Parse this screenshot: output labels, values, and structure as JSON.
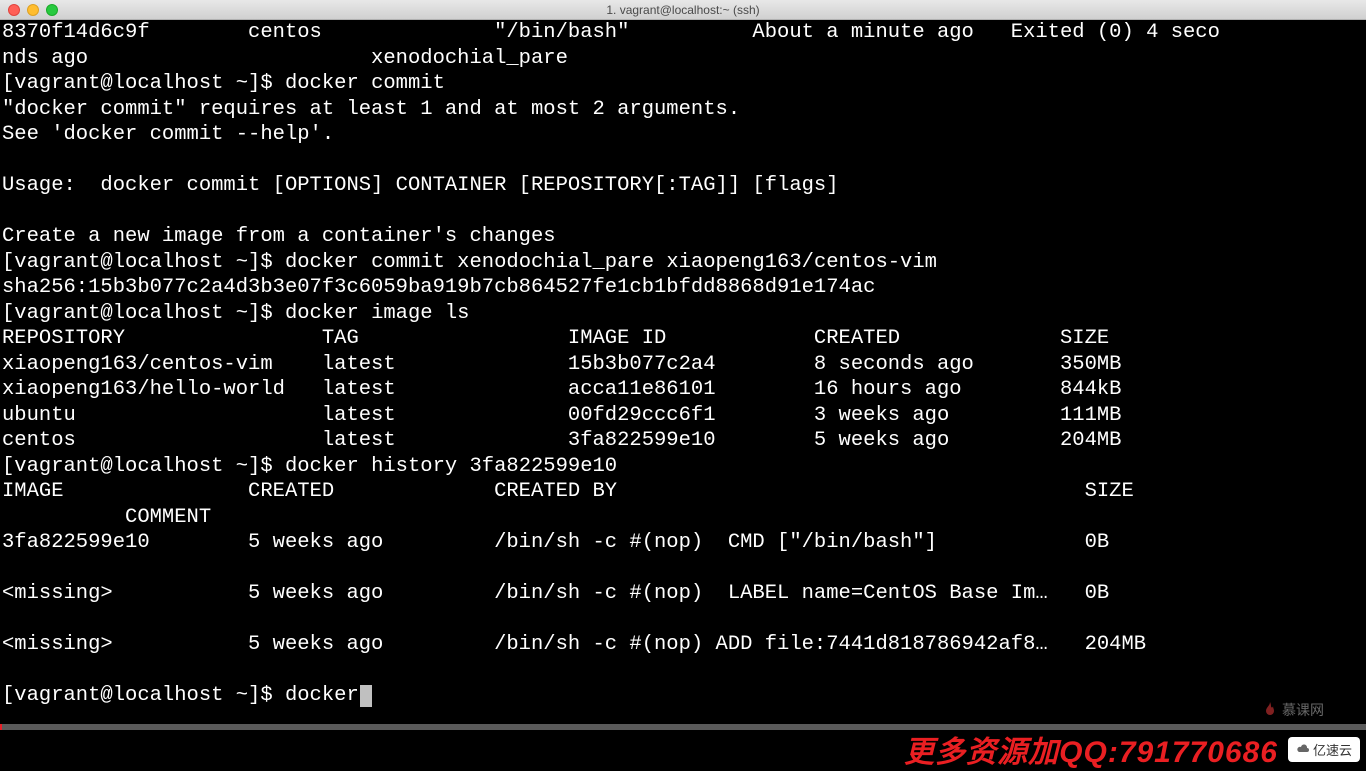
{
  "window": {
    "title": "1. vagrant@localhost:~ (ssh)"
  },
  "terminal": {
    "prompt": "[vagrant@localhost ~]$ ",
    "lines": {
      "l1": "8370f14d6c9f        centos              \"/bin/bash\"          About a minute ago   Exited (0) 4 seco",
      "l2": "nds ago                       xenodochial_pare",
      "l3_cmd": "docker commit",
      "l4": "\"docker commit\" requires at least 1 and at most 2 arguments.",
      "l5": "See 'docker commit --help'.",
      "l6": "",
      "l7": "Usage:  docker commit [OPTIONS] CONTAINER [REPOSITORY[:TAG]] [flags]",
      "l8": "",
      "l9": "Create a new image from a container's changes",
      "l10_cmd": "docker commit xenodochial_pare xiaopeng163/centos-vim",
      "l11": "sha256:15b3b077c2a4d3b3e07f3c6059ba919b7cb864527fe1cb1bfdd8868d91e174ac",
      "l12_cmd": "docker image ls",
      "image_table": {
        "header": "REPOSITORY                TAG                 IMAGE ID            CREATED             SIZE",
        "rows": [
          "xiaopeng163/centos-vim    latest              15b3b077c2a4        8 seconds ago       350MB",
          "xiaopeng163/hello-world   latest              acca11e86101        16 hours ago        844kB",
          "ubuntu                    latest              00fd29ccc6f1        3 weeks ago         111MB",
          "centos                    latest              3fa822599e10        5 weeks ago         204MB"
        ]
      },
      "l18_cmd": "docker history 3fa822599e10",
      "history_table": {
        "header1": "IMAGE               CREATED             CREATED BY                                      SIZE  ",
        "header2": "          COMMENT",
        "rows": [
          "3fa822599e10        5 weeks ago         /bin/sh -c #(nop)  CMD [\"/bin/bash\"]            0B    ",
          "",
          "<missing>           5 weeks ago         /bin/sh -c #(nop)  LABEL name=CentOS Base Im…   0B    ",
          "",
          "<missing>           5 weeks ago         /bin/sh -c #(nop) ADD file:7441d818786942af8…   204MB ",
          ""
        ]
      },
      "current_cmd": "docker"
    }
  },
  "watermarks": {
    "mukewang": "慕课网",
    "banner": "更多资源加QQ:791770686",
    "yisuyun": "亿速云"
  }
}
